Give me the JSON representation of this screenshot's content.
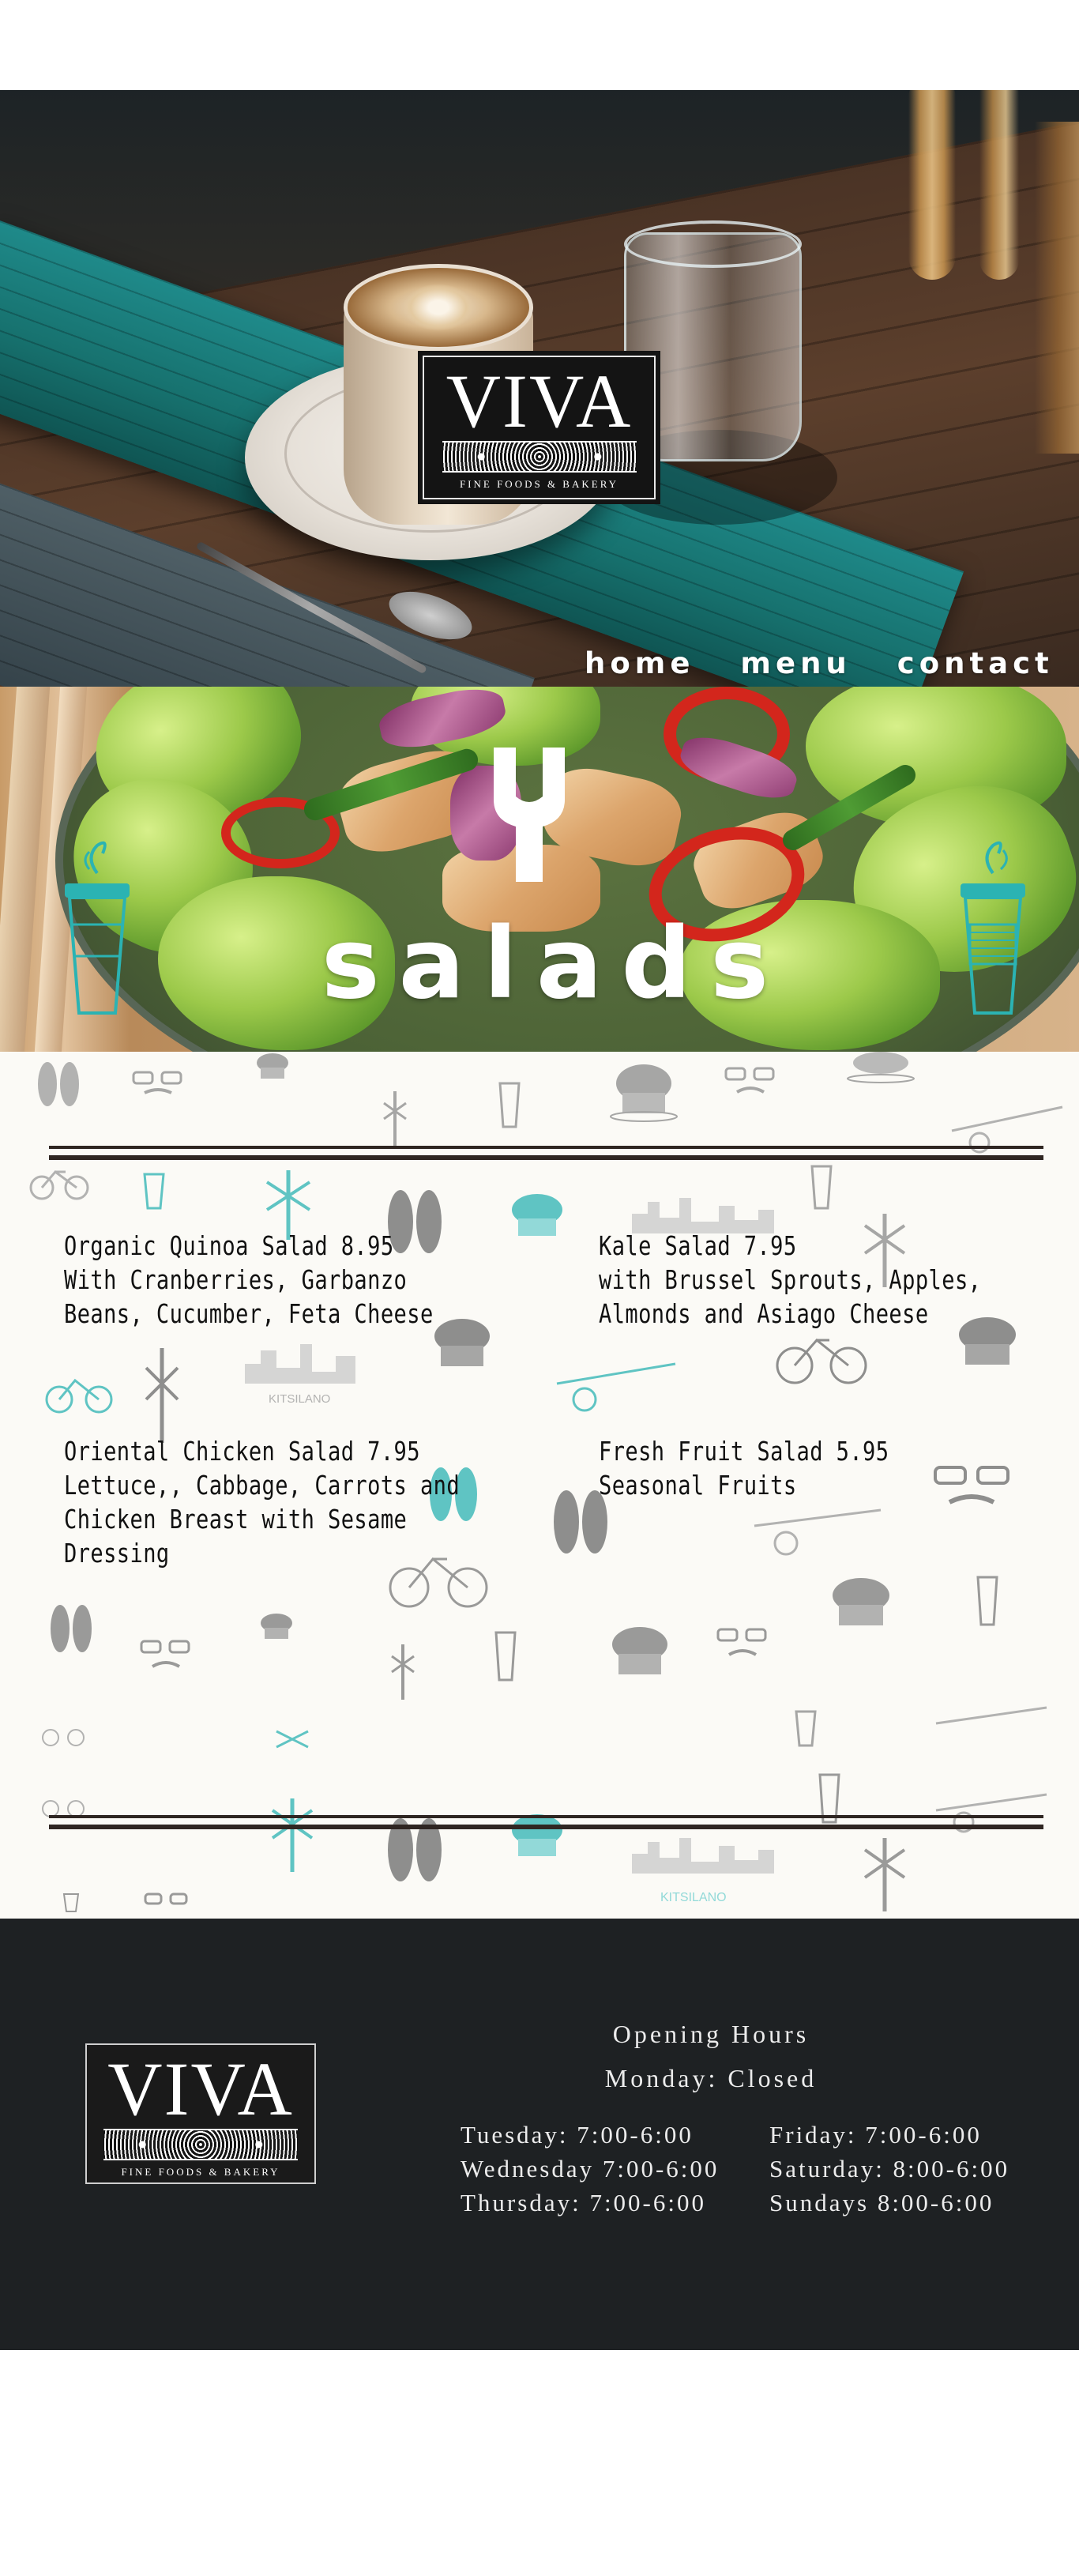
{
  "brand": {
    "name": "VIVA",
    "tagline": "FINE FOODS & BAKERY"
  },
  "nav": {
    "items": [
      "home",
      "menu",
      "contact"
    ]
  },
  "banner": {
    "title": "salads",
    "icon": "salad-fork-icon"
  },
  "menu": {
    "items": [
      {
        "lines": [
          "Organic Quinoa Salad 8.95",
          "With Cranberries, Garbanzo",
          "Beans, Cucumber, Feta Cheese"
        ]
      },
      {
        "lines": [
          "Kale Salad 7.95",
          "with Brussel Sprouts, Apples,",
          "Almonds and Asiago Cheese"
        ]
      },
      {
        "lines": [
          "Oriental Chicken Salad 7.95",
          "Lettuce,, Cabbage, Carrots and",
          "Chicken Breast with Sesame",
          "Dressing"
        ]
      },
      {
        "lines": [
          "Fresh Fruit Salad 5.95",
          "Seasonal Fruits"
        ]
      }
    ],
    "pattern_labels": [
      "KITSILANO",
      "KITSILANO"
    ]
  },
  "footer": {
    "hours_title": "Opening Hours",
    "closed": "Monday: Closed",
    "left_days": [
      "Tuesday: 7:00-6:00",
      "Wednesday 7:00-6:00",
      "Thursday: 7:00-6:00"
    ],
    "right_days": [
      "Friday: 7:00-6:00",
      "Saturday: 8:00-6:00",
      "Sundays 8:00-6:00"
    ]
  },
  "colors": {
    "teal_accent": "#2bb3b3",
    "footer_bg": "#1e2123",
    "rule": "#2f2622",
    "menu_bg": "#fbfaf6"
  }
}
